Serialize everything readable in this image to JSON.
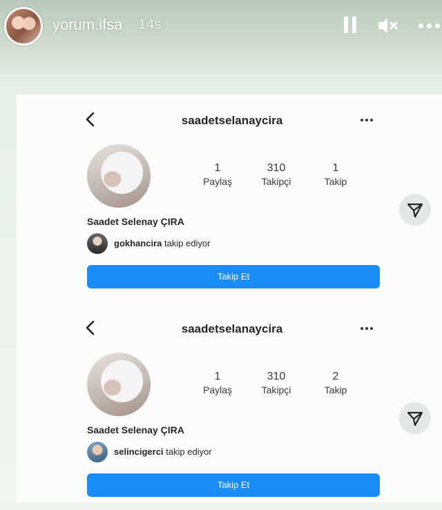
{
  "story": {
    "username": "yorum.ifsa",
    "time": "14s",
    "controls": [
      "pause-icon",
      "mute-icon",
      "more-icon"
    ]
  },
  "profiles": [
    {
      "username": "saadetselanaycira",
      "stats": [
        {
          "value": "1",
          "label": "Paylaş"
        },
        {
          "value": "310",
          "label": "Takipçi"
        },
        {
          "value": "1",
          "label": "Takip"
        }
      ],
      "full_name": "Saadet Selenay ÇIRA",
      "followed_by_user": "gokhancira",
      "followed_by_suffix": "takip ediyor",
      "follow_button": "Takip Et"
    },
    {
      "username": "saadetselanaycira",
      "stats": [
        {
          "value": "1",
          "label": "Paylaş"
        },
        {
          "value": "310",
          "label": "Takipçi"
        },
        {
          "value": "2",
          "label": "Takip"
        }
      ],
      "full_name": "Saadet Selenay ÇIRA",
      "followed_by_user": "selincigerci",
      "followed_by_suffix": "takip ediyor",
      "follow_button": "Takip Et"
    }
  ],
  "colors": {
    "follow_button": "#1a8cf5",
    "story_text": "#ffffff"
  }
}
